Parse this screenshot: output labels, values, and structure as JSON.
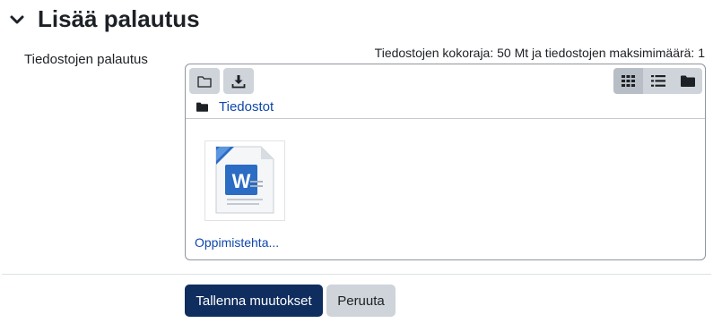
{
  "section": {
    "title": "Lisää palautus"
  },
  "field": {
    "label": "Tiedostojen palautus",
    "limits": "Tiedostojen kokoraja: 50 Mt ja tiedostojen maksimimäärä: 1"
  },
  "file_manager": {
    "toolbar": {
      "add_icon": "folder-outline-icon",
      "download_icon": "download-icon",
      "views": [
        {
          "icon": "grid-icon",
          "active": true
        },
        {
          "icon": "list-icon",
          "active": false
        },
        {
          "icon": "folder-tree-icon",
          "active": false
        }
      ]
    },
    "breadcrumb": "Tiedostot",
    "files": [
      {
        "name": "Oppimistehta...",
        "icon": "word-document-icon"
      }
    ]
  },
  "actions": {
    "save_label": "Tallenna muutokset",
    "cancel_label": "Peruuta"
  },
  "colors": {
    "primary": "#0f2d5e",
    "secondary": "#ced4da",
    "link": "#0f47ad",
    "word_blue": "#2b6cc4"
  }
}
